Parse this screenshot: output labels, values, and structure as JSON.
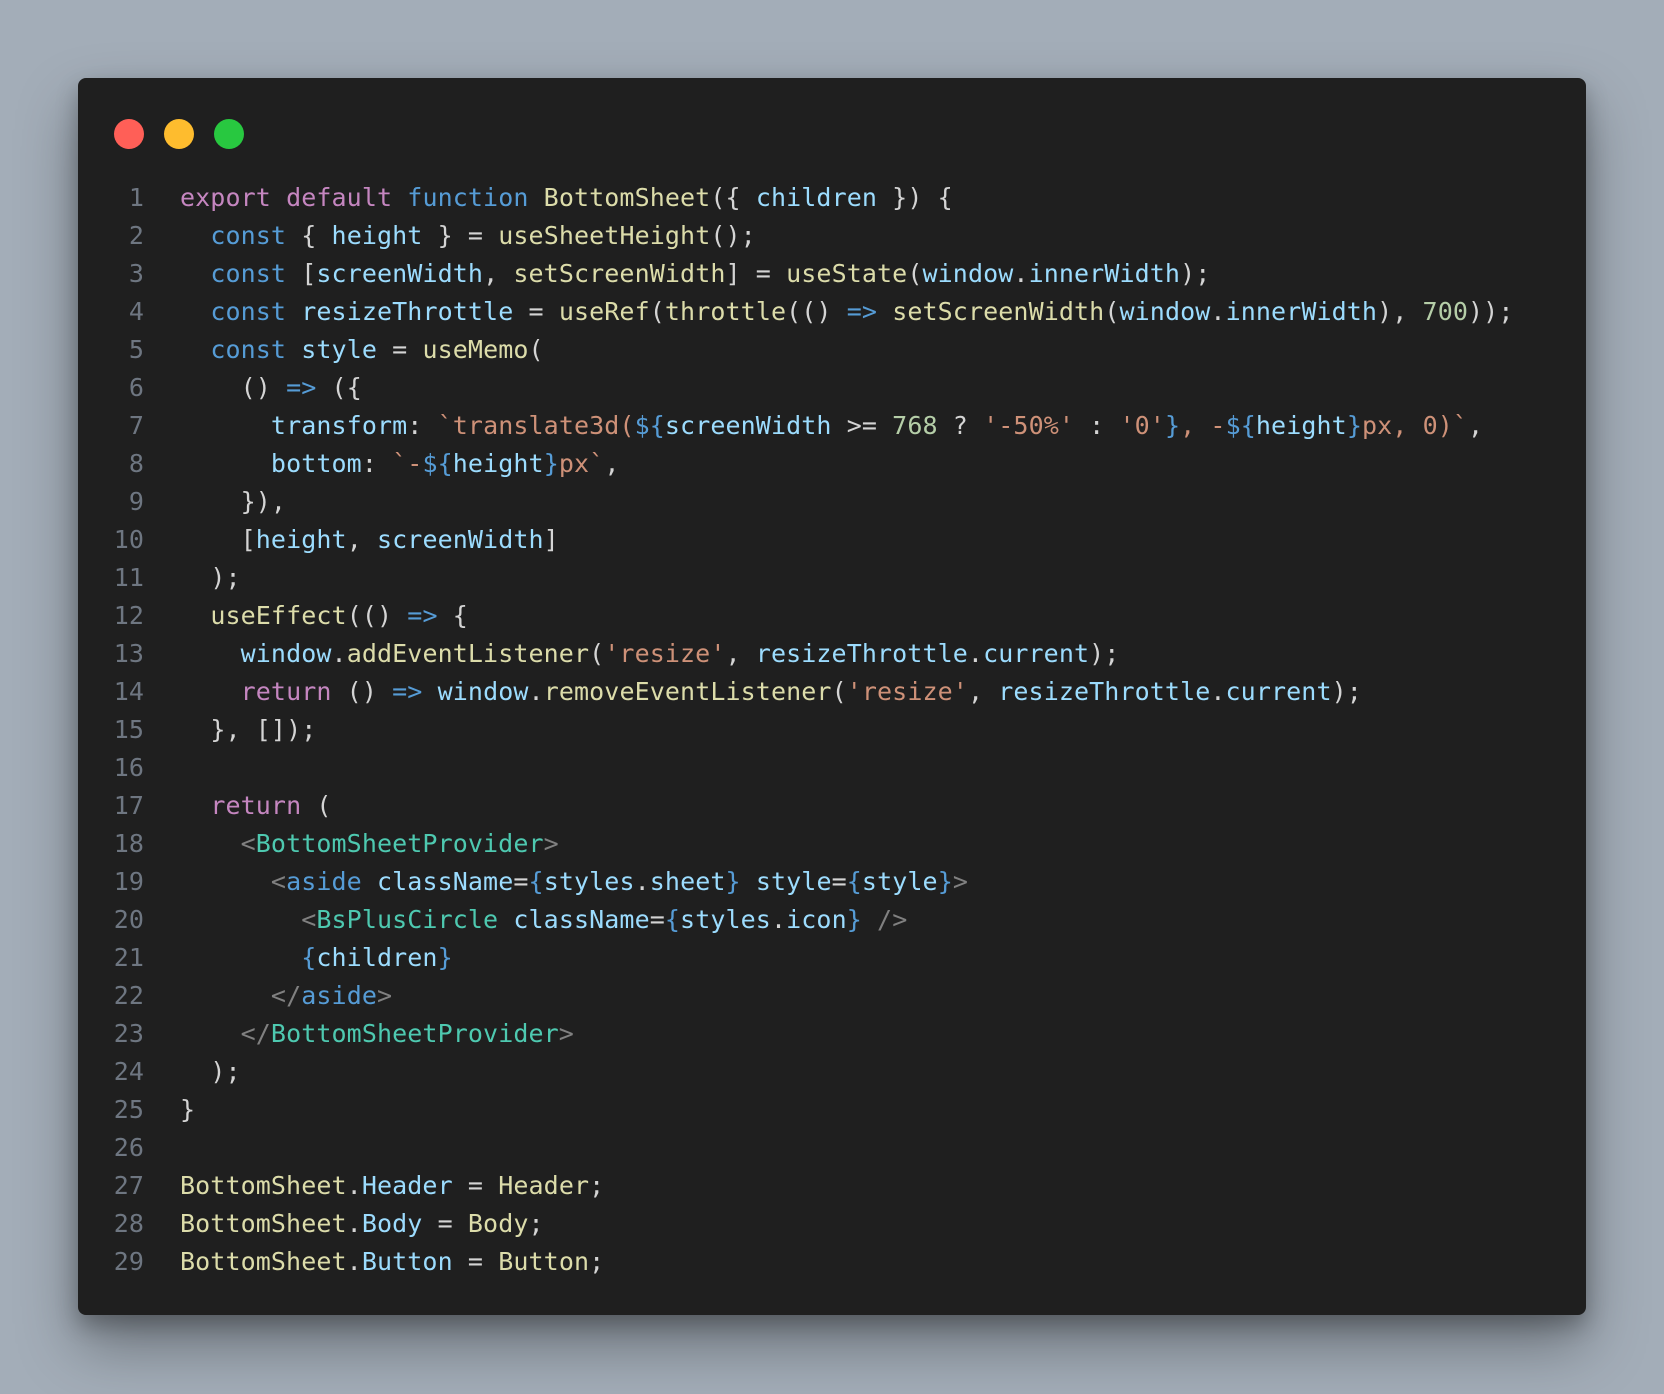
{
  "window_controls": [
    "close",
    "minimize",
    "maximize"
  ],
  "line_numbers": [
    "1",
    "2",
    "3",
    "4",
    "5",
    "6",
    "7",
    "8",
    "9",
    "10",
    "11",
    "12",
    "13",
    "14",
    "15",
    "16",
    "17",
    "18",
    "19",
    "20",
    "21",
    "22",
    "23",
    "24",
    "25",
    "26",
    "27",
    "28",
    "29"
  ],
  "code_lines": [
    [
      [
        "export",
        "kw"
      ],
      [
        " ",
        ""
      ],
      [
        "default",
        "kw"
      ],
      [
        " ",
        ""
      ],
      [
        "function",
        "st"
      ],
      [
        " ",
        ""
      ],
      [
        "BottomSheet",
        "fn"
      ],
      [
        "({ ",
        "pl"
      ],
      [
        "children",
        "var"
      ],
      [
        " }) {",
        "pl"
      ]
    ],
    [
      [
        "  ",
        ""
      ],
      [
        "const",
        "st"
      ],
      [
        " { ",
        "pl"
      ],
      [
        "height",
        "var"
      ],
      [
        " } = ",
        "pl"
      ],
      [
        "useSheetHeight",
        "fn"
      ],
      [
        "();",
        "pl"
      ]
    ],
    [
      [
        "  ",
        ""
      ],
      [
        "const",
        "st"
      ],
      [
        " [",
        "pl"
      ],
      [
        "screenWidth",
        "var"
      ],
      [
        ", ",
        "pl"
      ],
      [
        "setScreenWidth",
        "fn"
      ],
      [
        "] = ",
        "pl"
      ],
      [
        "useState",
        "fn"
      ],
      [
        "(",
        "pl"
      ],
      [
        "window",
        "var"
      ],
      [
        ".",
        "pl"
      ],
      [
        "innerWidth",
        "var"
      ],
      [
        ");",
        "pl"
      ]
    ],
    [
      [
        "  ",
        ""
      ],
      [
        "const",
        "st"
      ],
      [
        " ",
        ""
      ],
      [
        "resizeThrottle",
        "var"
      ],
      [
        " = ",
        "pl"
      ],
      [
        "useRef",
        "fn"
      ],
      [
        "(",
        "pl"
      ],
      [
        "throttle",
        "fn"
      ],
      [
        "(() ",
        "pl"
      ],
      [
        "=>",
        "st"
      ],
      [
        " ",
        ""
      ],
      [
        "setScreenWidth",
        "fn"
      ],
      [
        "(",
        "pl"
      ],
      [
        "window",
        "var"
      ],
      [
        ".",
        "pl"
      ],
      [
        "innerWidth",
        "var"
      ],
      [
        "), ",
        "pl"
      ],
      [
        "700",
        "num"
      ],
      [
        "));",
        "pl"
      ]
    ],
    [
      [
        "  ",
        ""
      ],
      [
        "const",
        "st"
      ],
      [
        " ",
        ""
      ],
      [
        "style",
        "var"
      ],
      [
        " = ",
        "pl"
      ],
      [
        "useMemo",
        "fn"
      ],
      [
        "(",
        "pl"
      ]
    ],
    [
      [
        "    ",
        ""
      ],
      [
        "() ",
        "pl"
      ],
      [
        "=>",
        "st"
      ],
      [
        " ({",
        "pl"
      ]
    ],
    [
      [
        "      ",
        ""
      ],
      [
        "transform",
        "var"
      ],
      [
        ": ",
        "pl"
      ],
      [
        "`translate3d(",
        "str"
      ],
      [
        "${",
        "st"
      ],
      [
        "screenWidth",
        "var"
      ],
      [
        " >= ",
        "pl"
      ],
      [
        "768",
        "num"
      ],
      [
        " ? ",
        "pl"
      ],
      [
        "'-50%'",
        "str"
      ],
      [
        " : ",
        "pl"
      ],
      [
        "'0'",
        "str"
      ],
      [
        "}",
        "st"
      ],
      [
        ", -",
        "str"
      ],
      [
        "${",
        "st"
      ],
      [
        "height",
        "var"
      ],
      [
        "}",
        "st"
      ],
      [
        "px, 0)`",
        "str"
      ],
      [
        ",",
        "pl"
      ]
    ],
    [
      [
        "      ",
        ""
      ],
      [
        "bottom",
        "var"
      ],
      [
        ": ",
        "pl"
      ],
      [
        "`-",
        "str"
      ],
      [
        "${",
        "st"
      ],
      [
        "height",
        "var"
      ],
      [
        "}",
        "st"
      ],
      [
        "px`",
        "str"
      ],
      [
        ",",
        "pl"
      ]
    ],
    [
      [
        "    ",
        ""
      ],
      [
        "}),",
        "pl"
      ]
    ],
    [
      [
        "    ",
        ""
      ],
      [
        "[",
        "pl"
      ],
      [
        "height",
        "var"
      ],
      [
        ", ",
        "pl"
      ],
      [
        "screenWidth",
        "var"
      ],
      [
        "]",
        "pl"
      ]
    ],
    [
      [
        "  ",
        ""
      ],
      [
        ");",
        "pl"
      ]
    ],
    [
      [
        "  ",
        ""
      ],
      [
        "useEffect",
        "fn"
      ],
      [
        "(() ",
        "pl"
      ],
      [
        "=>",
        "st"
      ],
      [
        " {",
        "pl"
      ]
    ],
    [
      [
        "    ",
        ""
      ],
      [
        "window",
        "var"
      ],
      [
        ".",
        "pl"
      ],
      [
        "addEventListener",
        "fn"
      ],
      [
        "(",
        "pl"
      ],
      [
        "'resize'",
        "str"
      ],
      [
        ", ",
        "pl"
      ],
      [
        "resizeThrottle",
        "var"
      ],
      [
        ".",
        "pl"
      ],
      [
        "current",
        "var"
      ],
      [
        ");",
        "pl"
      ]
    ],
    [
      [
        "    ",
        ""
      ],
      [
        "return",
        "kw"
      ],
      [
        " () ",
        "pl"
      ],
      [
        "=>",
        "st"
      ],
      [
        " ",
        ""
      ],
      [
        "window",
        "var"
      ],
      [
        ".",
        "pl"
      ],
      [
        "removeEventListener",
        "fn"
      ],
      [
        "(",
        "pl"
      ],
      [
        "'resize'",
        "str"
      ],
      [
        ", ",
        "pl"
      ],
      [
        "resizeThrottle",
        "var"
      ],
      [
        ".",
        "pl"
      ],
      [
        "current",
        "var"
      ],
      [
        ");",
        "pl"
      ]
    ],
    [
      [
        "  ",
        ""
      ],
      [
        "}, []);",
        "pl"
      ]
    ],
    [],
    [
      [
        "  ",
        ""
      ],
      [
        "return",
        "kw"
      ],
      [
        " (",
        "pl"
      ]
    ],
    [
      [
        "    ",
        ""
      ],
      [
        "<",
        "pun"
      ],
      [
        "BottomSheetProvider",
        "tag"
      ],
      [
        ">",
        "pun"
      ]
    ],
    [
      [
        "      ",
        ""
      ],
      [
        "<",
        "pun"
      ],
      [
        "aside",
        "st"
      ],
      [
        " ",
        ""
      ],
      [
        "className",
        "var"
      ],
      [
        "=",
        "pl"
      ],
      [
        "{",
        "st"
      ],
      [
        "styles",
        "var"
      ],
      [
        ".",
        "pl"
      ],
      [
        "sheet",
        "var"
      ],
      [
        "}",
        "st"
      ],
      [
        " ",
        ""
      ],
      [
        "style",
        "var"
      ],
      [
        "=",
        "pl"
      ],
      [
        "{",
        "st"
      ],
      [
        "style",
        "var"
      ],
      [
        "}",
        "st"
      ],
      [
        ">",
        "pun"
      ]
    ],
    [
      [
        "        ",
        ""
      ],
      [
        "<",
        "pun"
      ],
      [
        "BsPlusCircle",
        "tag"
      ],
      [
        " ",
        ""
      ],
      [
        "className",
        "var"
      ],
      [
        "=",
        "pl"
      ],
      [
        "{",
        "st"
      ],
      [
        "styles",
        "var"
      ],
      [
        ".",
        "pl"
      ],
      [
        "icon",
        "var"
      ],
      [
        "}",
        "st"
      ],
      [
        " />",
        "pun"
      ]
    ],
    [
      [
        "        ",
        ""
      ],
      [
        "{",
        "st"
      ],
      [
        "children",
        "var"
      ],
      [
        "}",
        "st"
      ]
    ],
    [
      [
        "      ",
        ""
      ],
      [
        "</",
        "pun"
      ],
      [
        "aside",
        "st"
      ],
      [
        ">",
        "pun"
      ]
    ],
    [
      [
        "    ",
        ""
      ],
      [
        "</",
        "pun"
      ],
      [
        "BottomSheetProvider",
        "tag"
      ],
      [
        ">",
        "pun"
      ]
    ],
    [
      [
        "  ",
        ""
      ],
      [
        ");",
        "pl"
      ]
    ],
    [
      [
        "}",
        "pl"
      ]
    ],
    [],
    [
      [
        "BottomSheet",
        "fn"
      ],
      [
        ".",
        "pl"
      ],
      [
        "Header",
        "var"
      ],
      [
        " = ",
        "pl"
      ],
      [
        "Header",
        "fn"
      ],
      [
        ";",
        "pl"
      ]
    ],
    [
      [
        "BottomSheet",
        "fn"
      ],
      [
        ".",
        "pl"
      ],
      [
        "Body",
        "var"
      ],
      [
        " = ",
        "pl"
      ],
      [
        "Body",
        "fn"
      ],
      [
        ";",
        "pl"
      ]
    ],
    [
      [
        "BottomSheet",
        "fn"
      ],
      [
        ".",
        "pl"
      ],
      [
        "Button",
        "var"
      ],
      [
        " = ",
        "pl"
      ],
      [
        "Button",
        "fn"
      ],
      [
        ";",
        "pl"
      ]
    ]
  ],
  "colors": {
    "background": "#a3adb8",
    "window": "#1f1f1f",
    "close": "#ff5f57",
    "minimize": "#febc2e",
    "maximize": "#28c840",
    "keyword": "#c586c0",
    "storage": "#569cd6",
    "function": "#dcdcaa",
    "variable": "#9cdcfe",
    "string": "#ce9178",
    "number": "#b5cea8",
    "tag": "#4ec9b0"
  }
}
